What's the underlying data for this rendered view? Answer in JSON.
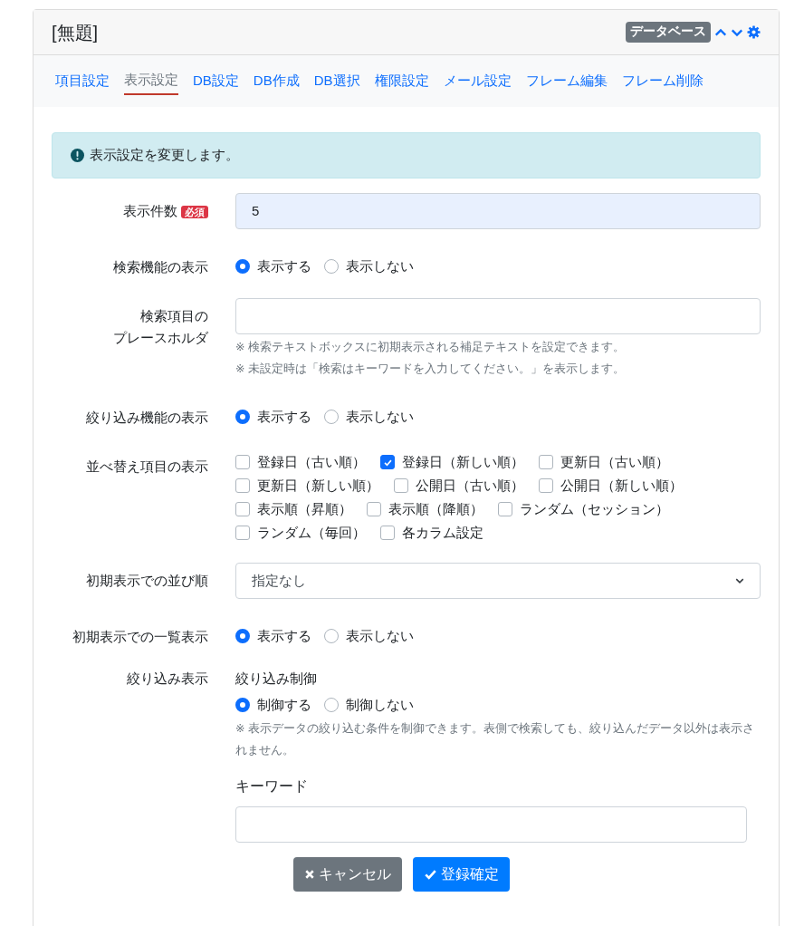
{
  "frame": {
    "title": "[無題]",
    "badge": "データベース"
  },
  "tabs": [
    {
      "label": "項目設定",
      "selected": false
    },
    {
      "label": "表示設定",
      "selected": true
    },
    {
      "label": "DB設定",
      "selected": false
    },
    {
      "label": "DB作成",
      "selected": false
    },
    {
      "label": "DB選択",
      "selected": false
    },
    {
      "label": "権限設定",
      "selected": false
    },
    {
      "label": "メール設定",
      "selected": false
    },
    {
      "label": "フレーム編集",
      "selected": false
    },
    {
      "label": "フレーム削除",
      "selected": false
    }
  ],
  "alert": "表示設定を変更します。",
  "fields": [
    {
      "kind": "text",
      "label_lines": [
        "表示件数"
      ],
      "required_badge": "必須",
      "value": "5",
      "autofilled": true
    },
    {
      "kind": "radio",
      "label_lines": [
        "検索機能の表示"
      ],
      "options": [
        {
          "label": "表示する",
          "selected": true
        },
        {
          "label": "表示しない",
          "selected": false
        }
      ]
    },
    {
      "kind": "text",
      "label_lines": [
        "検索項目の",
        "プレースホルダ"
      ],
      "autofilled": false,
      "help": [
        "※ 検索テキストボックスに初期表示される補足テキストを設定できます。",
        "※ 未設定時は「検索はキーワードを入力してください。」を表示します。"
      ]
    },
    {
      "kind": "radio",
      "label_lines": [
        "絞り込み機能の表示"
      ],
      "options": [
        {
          "label": "表示する",
          "selected": true
        },
        {
          "label": "表示しない",
          "selected": false
        }
      ]
    },
    {
      "kind": "checkboxes",
      "label_lines": [
        "並べ替え項目の表示"
      ],
      "options": [
        {
          "label": "登録日（古い順）",
          "checked": false
        },
        {
          "label": "登録日（新しい順）",
          "checked": true
        },
        {
          "label": "更新日（古い順）",
          "checked": false
        },
        {
          "label": "更新日（新しい順）",
          "checked": false
        },
        {
          "label": "公開日（古い順）",
          "checked": false
        },
        {
          "label": "公開日（新しい順）",
          "checked": false
        },
        {
          "label": "表示順（昇順）",
          "checked": false
        },
        {
          "label": "表示順（降順）",
          "checked": false
        },
        {
          "label": "ランダム（セッション）",
          "checked": false
        },
        {
          "label": "ランダム（毎回）",
          "checked": false
        },
        {
          "label": "各カラム設定",
          "checked": false
        }
      ]
    },
    {
      "kind": "select",
      "label_lines": [
        "初期表示での並び順"
      ],
      "value": "指定なし"
    },
    {
      "kind": "radio",
      "label_lines": [
        "初期表示での一覧表示"
      ],
      "options": [
        {
          "label": "表示する",
          "selected": true
        },
        {
          "label": "表示しない",
          "selected": false
        }
      ]
    },
    {
      "kind": "group",
      "label_lines": [
        "絞り込み表示"
      ],
      "heading": "絞り込み制御",
      "options": [
        {
          "label": "制御する",
          "selected": true
        },
        {
          "label": "制御しない",
          "selected": false
        }
      ],
      "help": [
        "※ 表示データの絞り込む条件を制御できます。表側で検索しても、絞り込んだデータ以外は表示されません。"
      ],
      "keyword": {
        "label": "キーワード"
      }
    }
  ],
  "buttons": [
    {
      "kind": "cancel",
      "label": "キャンセル"
    },
    {
      "kind": "submit",
      "label": "登録確定"
    }
  ]
}
